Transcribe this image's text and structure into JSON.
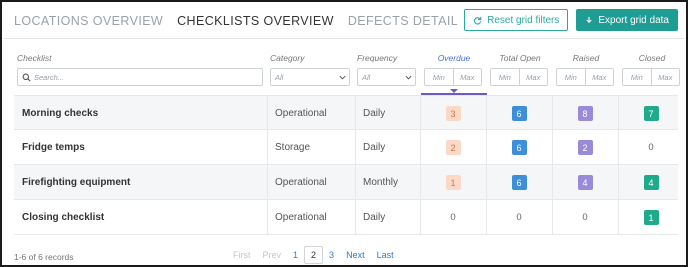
{
  "tabs": [
    "LOCATIONS OVERVIEW",
    "CHECKLISTS OVERVIEW",
    "DEFECTS DETAIL"
  ],
  "active_tab": 1,
  "buttons": {
    "reset": "Reset grid filters",
    "export": "Export grid data"
  },
  "columns": {
    "checklist": "Checklist",
    "category": "Category",
    "frequency": "Frequency",
    "overdue": "Overdue",
    "total_open": "Total Open",
    "raised": "Raised",
    "closed": "Closed"
  },
  "filters": {
    "search_placeholder": "Search...",
    "category_value": "All",
    "frequency_value": "All",
    "min": "Min",
    "max": "Max"
  },
  "rows": [
    {
      "name": "Morning checks",
      "category": "Operational",
      "frequency": "Daily",
      "overdue": "3",
      "total_open": "6",
      "raised": "8",
      "closed": "7"
    },
    {
      "name": "Fridge temps",
      "category": "Storage",
      "frequency": "Daily",
      "overdue": "2",
      "total_open": "6",
      "raised": "2",
      "closed": "0"
    },
    {
      "name": "Firefighting equipment",
      "category": "Operational",
      "frequency": "Monthly",
      "overdue": "1",
      "total_open": "6",
      "raised": "4",
      "closed": "4"
    },
    {
      "name": "Closing checklist",
      "category": "Operational",
      "frequency": "Daily",
      "overdue": "0",
      "total_open": "0",
      "raised": "0",
      "closed": "1"
    }
  ],
  "footer": {
    "records": "1-6 of 6 records",
    "first": "First",
    "prev": "Prev",
    "pages": [
      "1",
      "2",
      "3"
    ],
    "current_page": "2",
    "next": "Next",
    "last": "Last"
  },
  "colors": {
    "accent": "#1f9d95",
    "overdue": "#fbd9c6",
    "open": "#3c8fd8",
    "raised": "#9a8ad8",
    "closed": "#1faa8b"
  }
}
